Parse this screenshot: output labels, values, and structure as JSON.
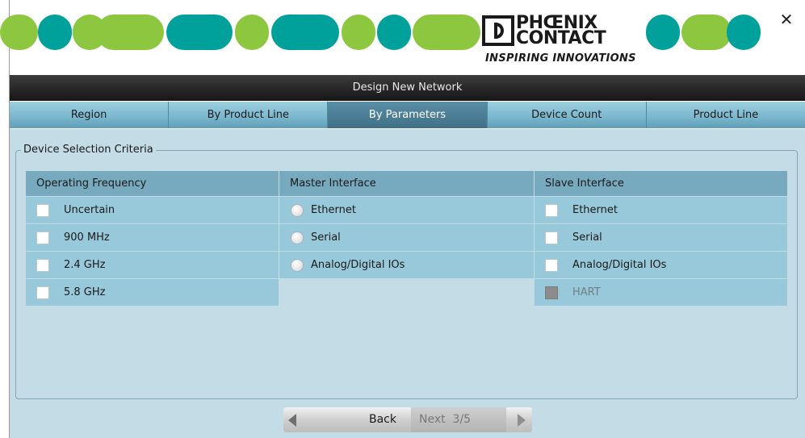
{
  "window": {
    "title": "Design New Network",
    "close_icon": "close-icon",
    "close_glyph": "✕"
  },
  "brand": {
    "name_line1": "PHŒNIX",
    "name_line2": "CONTACT",
    "tagline": "INSPIRING INNOVATIONS",
    "colors": {
      "green": "#8dc63f",
      "teal": "#00a19a"
    }
  },
  "tabs": [
    {
      "label": "Region",
      "active": false
    },
    {
      "label": "By Product Line",
      "active": false
    },
    {
      "label": "By Parameters",
      "active": true
    },
    {
      "label": "Device Count",
      "active": false
    },
    {
      "label": "Product Line",
      "active": false
    }
  ],
  "criteria": {
    "legend": "Device Selection Criteria",
    "operating_frequency": {
      "header": "Operating Frequency",
      "options": [
        {
          "label": "Uncertain",
          "checked": false
        },
        {
          "label": "900 MHz",
          "checked": false
        },
        {
          "label": "2.4 GHz",
          "checked": false
        },
        {
          "label": "5.8 GHz",
          "checked": false
        }
      ]
    },
    "master_interface": {
      "header": "Master Interface",
      "options": [
        {
          "label": "Ethernet",
          "selected": false
        },
        {
          "label": "Serial",
          "selected": false
        },
        {
          "label": "Analog/Digital IOs",
          "selected": false
        }
      ]
    },
    "slave_interface": {
      "header": "Slave Interface",
      "options": [
        {
          "label": "Ethernet",
          "checked": false
        },
        {
          "label": "Serial",
          "checked": false
        },
        {
          "label": "Analog/Digital IOs",
          "checked": false
        },
        {
          "label": "HART",
          "checked": false,
          "disabled": true
        }
      ]
    }
  },
  "navigation": {
    "back_label": "Back",
    "next_label": "Next",
    "step": "3/5"
  }
}
